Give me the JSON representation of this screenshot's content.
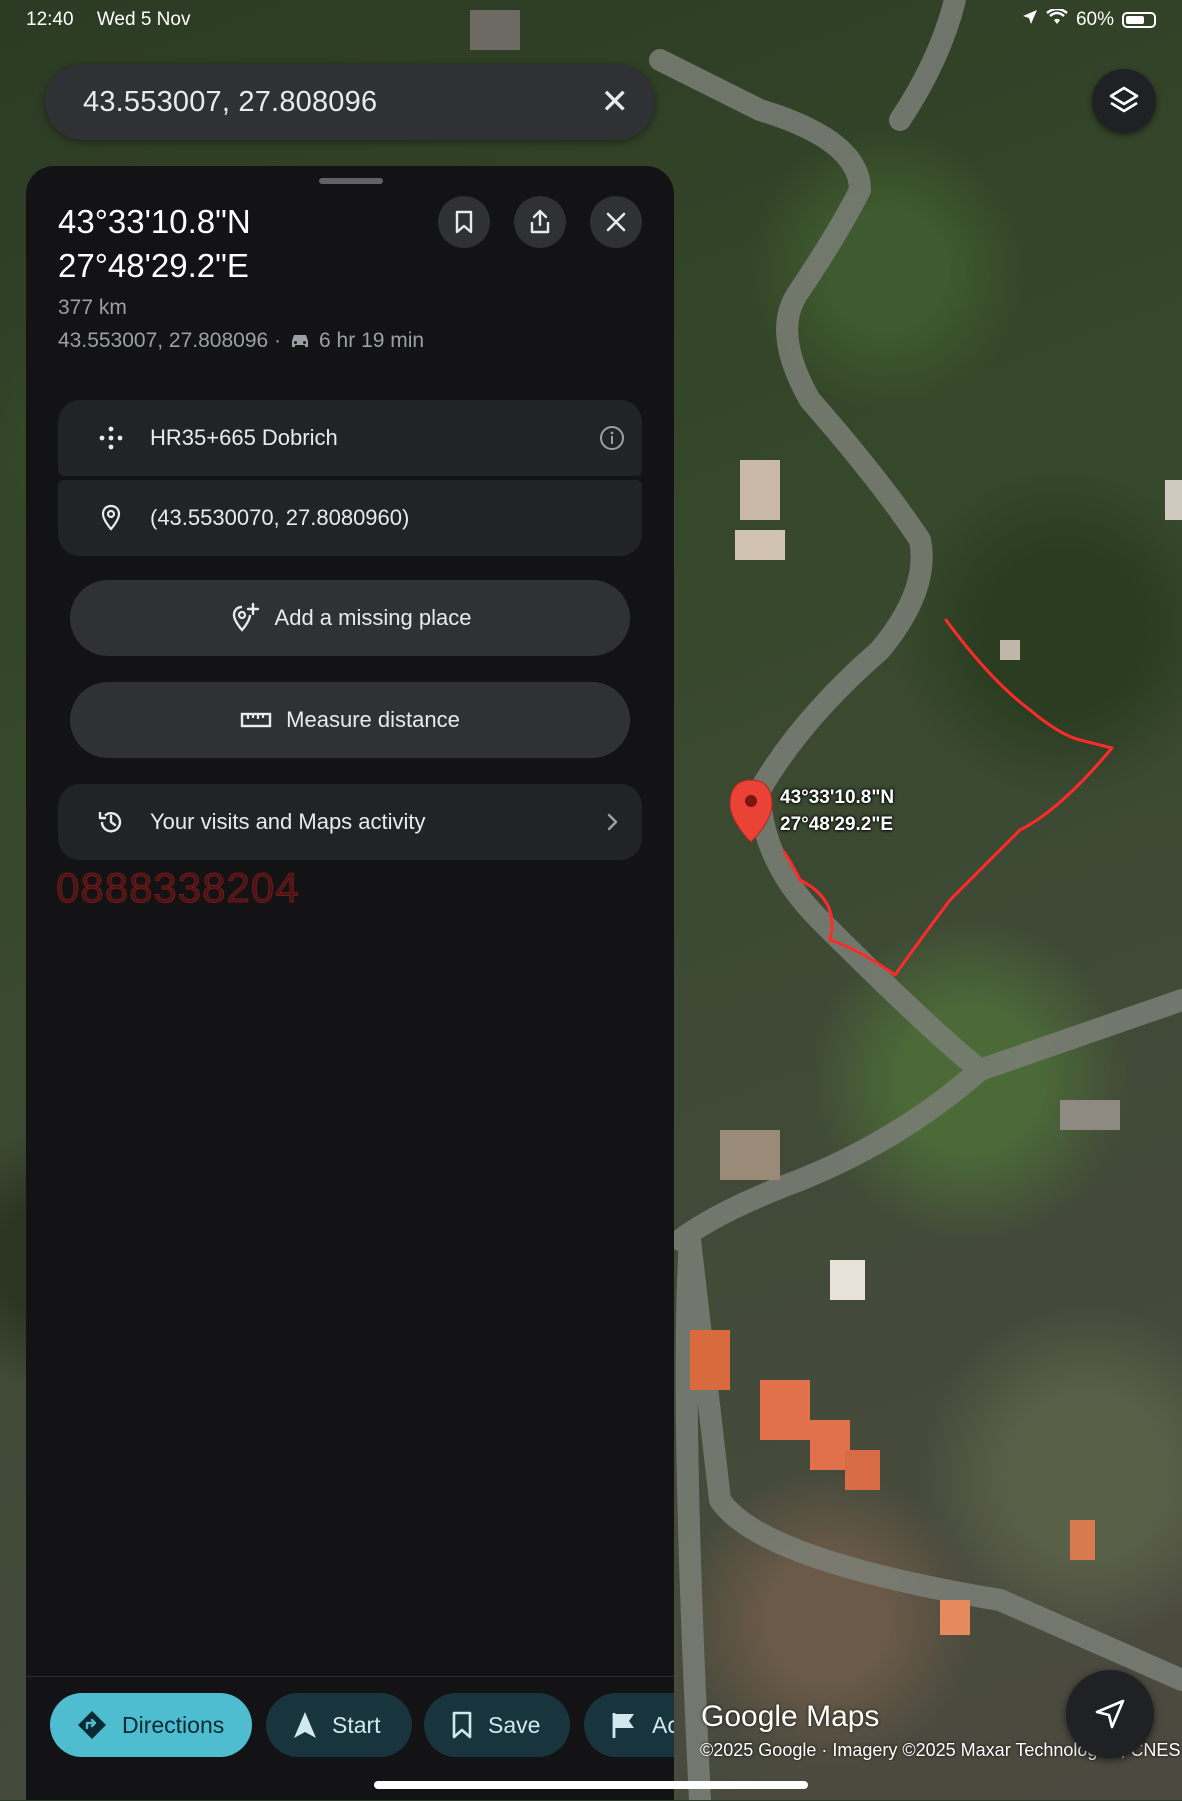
{
  "status_bar": {
    "time": "12:40",
    "date": "Wed 5 Nov",
    "battery": "60%"
  },
  "search": {
    "query": "43.553007, 27.808096"
  },
  "place": {
    "title_lat": "43°33'10.8\"N",
    "title_lng": "27°48'29.2\"E",
    "distance": "377 km",
    "coords": "43.553007, 27.808096 ·",
    "drive_time": "6 hr 19 min",
    "plus_code": "HR35+665 Dobrich",
    "precise_coords": "(43.5530070, 27.8080960)"
  },
  "actions": {
    "add_missing_place": "Add a missing place",
    "measure_distance": "Measure distance",
    "visits_activity": "Your visits and Maps activity"
  },
  "overlay_text": {
    "phone_number": "0888338204"
  },
  "bottom_bar": {
    "directions": "Directions",
    "start": "Start",
    "save": "Save",
    "add_label": "Ac"
  },
  "map": {
    "pin_label_lat": "43°33'10.8\"N",
    "pin_label_lng": "27°48'29.2\"E",
    "brand": "Google Maps",
    "copyright": "©2025 Google · Imagery ©2025 Maxar Technologies, CNES"
  },
  "colors": {
    "accent": "#4fbdd0",
    "panel": "#131315",
    "pin": "#ea4335",
    "drawn_outline": "#ff2a2a"
  }
}
